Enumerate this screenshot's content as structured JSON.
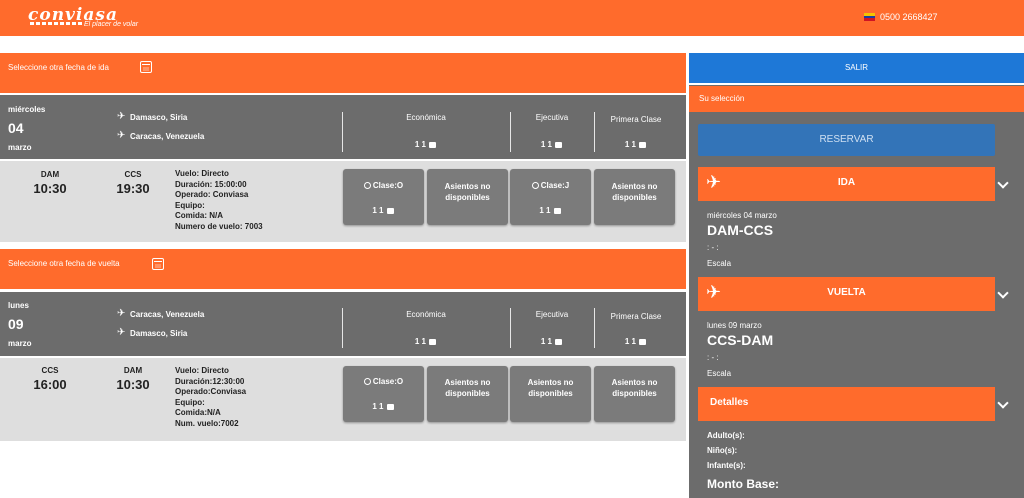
{
  "header": {
    "brand": "conviasa",
    "slogan": "El placer de volar",
    "phone": "0500 2668427"
  },
  "outbound": {
    "select_date_label": "Seleccione otra fecha de ida",
    "weekday": "miércoles",
    "day": "04",
    "month": "marzo",
    "origin_city": "Damasco, Siria",
    "dest_city": "Caracas, Venezuela",
    "classes": [
      {
        "name": "Económica",
        "count": "1  1"
      },
      {
        "name": "Ejecutiva",
        "count": "1  1"
      },
      {
        "name": "Primera Clase",
        "count": "1  1"
      }
    ],
    "from_code": "DAM",
    "from_time": "10:30",
    "to_code": "CCS",
    "to_time": "19:30",
    "details": [
      "Vuelo: Directo",
      "Duración: 15:00:00",
      "Operado: Conviasa",
      "Equipo:",
      "Comida: N/A",
      "Numero de vuelo: 7003"
    ],
    "boxes": [
      {
        "label": "Clase:O",
        "count": "1  1"
      },
      {
        "label": "Asientos no disponibles"
      },
      {
        "label": "Clase:J",
        "count": "1  1"
      },
      {
        "label": "Asientos no disponibles"
      }
    ]
  },
  "return": {
    "select_date_label": "Seleccione otra fecha de vuelta",
    "weekday": "lunes",
    "day": "09",
    "month": "marzo",
    "origin_city": "Caracas, Venezuela",
    "dest_city": "Damasco, Siria",
    "classes": [
      {
        "name": "Económica",
        "count": "1  1"
      },
      {
        "name": "Ejecutiva",
        "count": "1  1"
      },
      {
        "name": "Primera Clase",
        "count": "1  1"
      }
    ],
    "from_code": "CCS",
    "from_time": "16:00",
    "to_code": "DAM",
    "to_time": "10:30",
    "details": [
      "Vuelo: Directo",
      "Duración:12:30:00",
      "Operado:Conviasa",
      "Equipo:",
      "Comida:N/A",
      "Num. vuelo:7002"
    ],
    "boxes": [
      {
        "label": "Clase:O",
        "count": "1  1"
      },
      {
        "label": "Asientos no disponibles"
      },
      {
        "label": "Asientos no disponibles"
      },
      {
        "label": "Asientos no disponibles"
      }
    ]
  },
  "sidebar": {
    "salir": "SALIR",
    "selection": "Su selección",
    "reservar": "RESERVAR",
    "ida": {
      "title": "IDA",
      "date": "miércoles 04 marzo",
      "route": "DAM-CCS",
      "time": ": - :",
      "escala": "Escala"
    },
    "vuelta": {
      "title": "VUELTA",
      "date": "lunes 09 marzo",
      "route": "CCS-DAM",
      "time": ": - :",
      "escala": "Escala"
    },
    "detalles": {
      "title": "Detalles",
      "adults": "Adulto(s):",
      "children": "Niño(s):",
      "infants": "Infante(s):",
      "monto": "Monto Base:"
    }
  },
  "colors": {
    "orange": "#ff6b2c",
    "gray": "#6c6c6c",
    "light": "#dedede",
    "blue": "#1e78d7"
  }
}
